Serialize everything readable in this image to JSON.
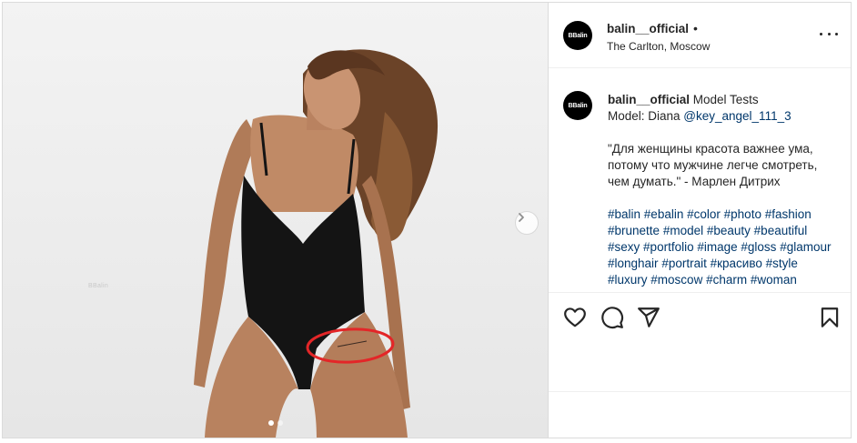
{
  "post": {
    "username": "balin__official",
    "bullet": "•",
    "location": "The Carlton, Moscow",
    "avatar_text": "ΒBalin"
  },
  "media": {
    "watermark": "ΒBalin",
    "slide_count": 2,
    "active_slide": 1,
    "annotation_color": "#e32628"
  },
  "caption": {
    "username": "balin__official",
    "line1_rest": " Model Tests",
    "line2_prefix": "Model: Diana ",
    "mention": "@key_angel_111_3",
    "quote_line1": "\"Для женщины красота важнее ума,",
    "quote_line2": "потому что мужчине легче смотреть,",
    "quote_line3": "чем думать.\" - Марлен Дитрих",
    "hashtags": [
      [
        "#balin",
        "#ebalin",
        "#color",
        "#photo",
        "#fashion"
      ],
      [
        "#brunette",
        "#model",
        "#beauty",
        "#beautiful"
      ],
      [
        "#sexy",
        "#portfolio",
        "#image",
        "#gloss",
        "#glamour"
      ],
      [
        "#longhair",
        "#portrait",
        "#красиво",
        "#style"
      ],
      [
        "#luxury",
        "#moscow",
        "#charm",
        "#woman"
      ]
    ]
  },
  "colors": {
    "link": "#00376b",
    "text": "#262626",
    "border": "#dbdbdb"
  }
}
